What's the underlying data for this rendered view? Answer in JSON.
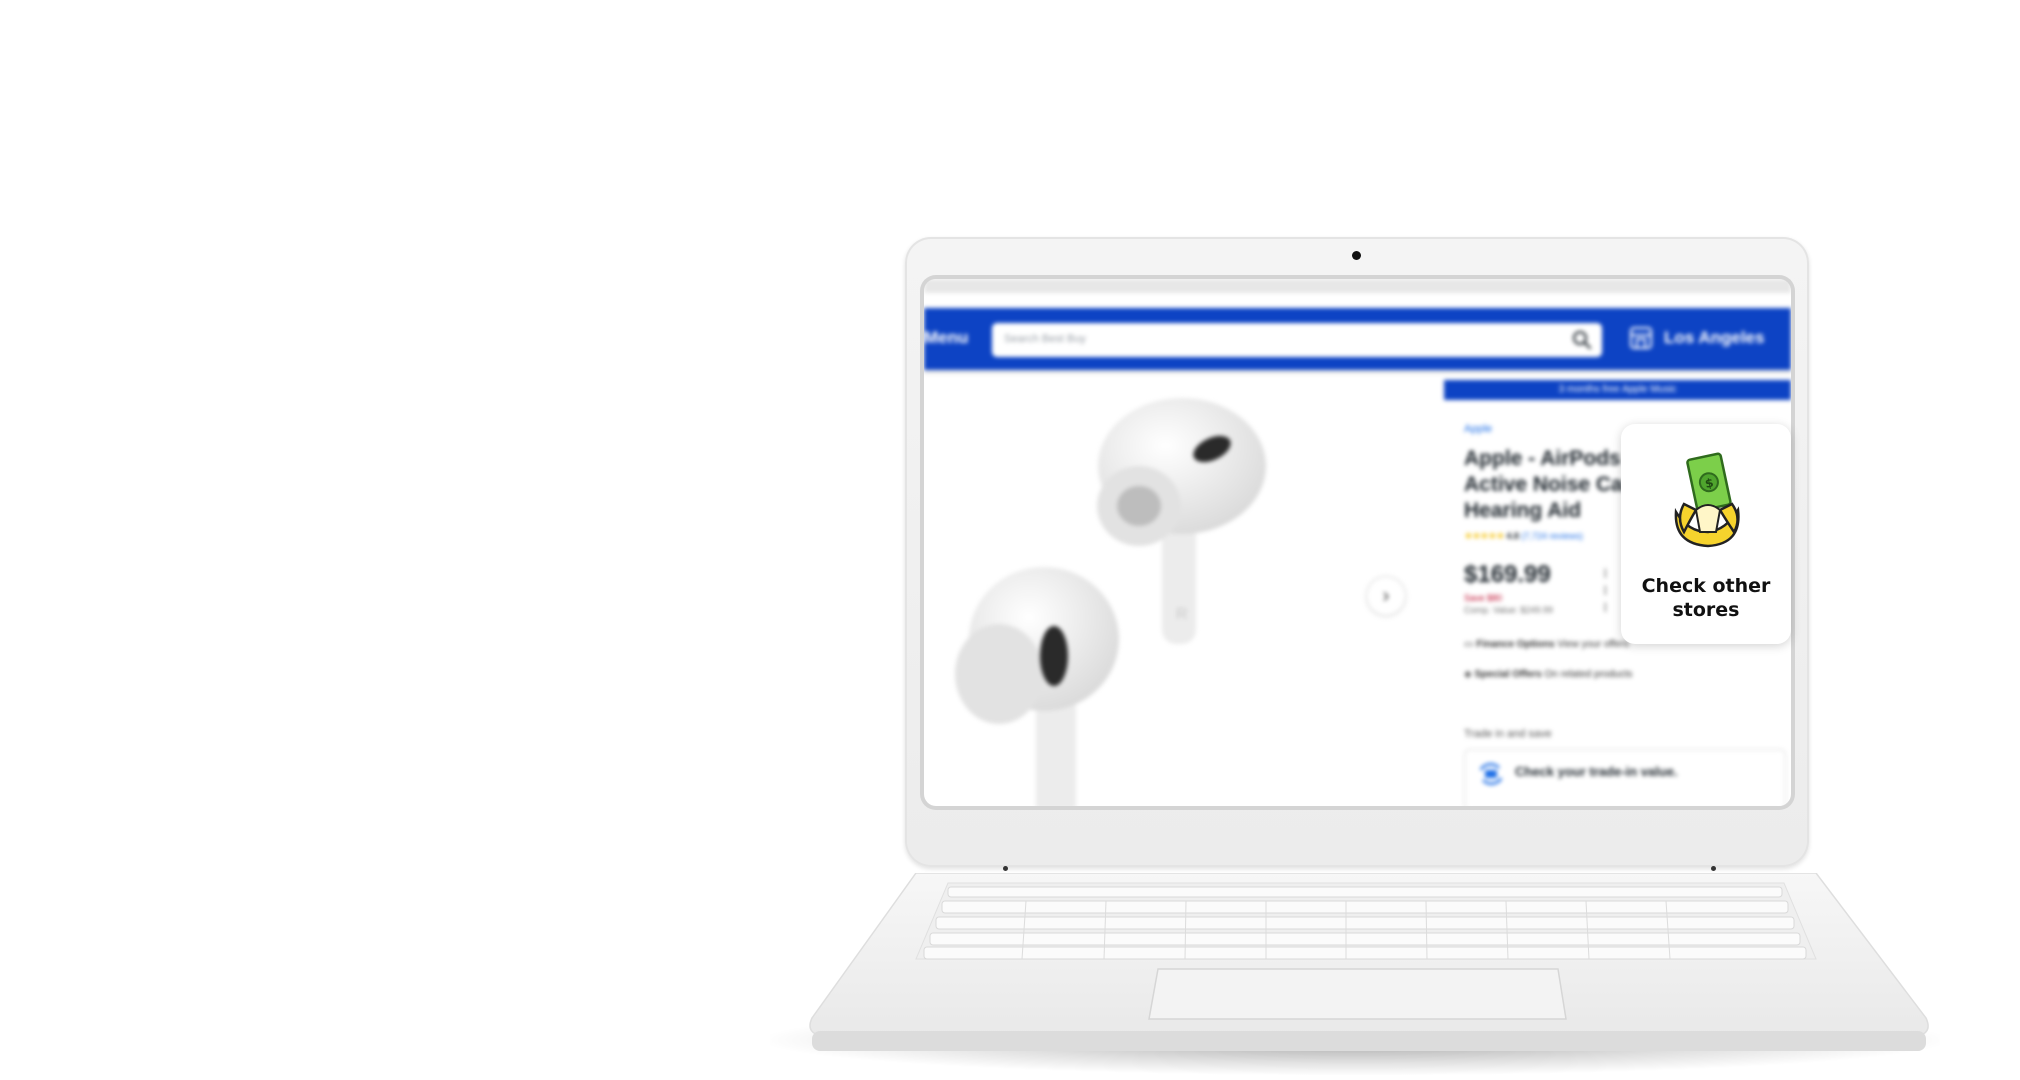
{
  "store_page": {
    "header": {
      "menu_label": "Menu",
      "search_placeholder": "Search Best Buy",
      "store_location": "Los Angeles"
    },
    "promo_banner": "3 months free Apple Music",
    "product": {
      "brand": "Apple",
      "title": "Apple - AirPods Pro 2 Wireless Active Noise Cancelling with Hearing Aid",
      "rating": "4.8",
      "review_count": "(7,724 reviews)",
      "price": "$169.99",
      "save_text": "Save $80",
      "comp_value": "Comp. Value: $249.99"
    },
    "finance_options": {
      "label": "Finance Options",
      "detail": "View your offers"
    },
    "special_offers": {
      "label": "Special Offers",
      "detail": "On related products"
    },
    "trade_in": {
      "heading": "Trade in and save",
      "cta": "Check your trade-in value."
    }
  },
  "popup": {
    "label": "Check other stores",
    "icon": "banana-money-icon"
  },
  "colors": {
    "brand_blue": "#0d43c4",
    "price_red": "#bb0628",
    "link_blue": "#1d6ee6"
  }
}
